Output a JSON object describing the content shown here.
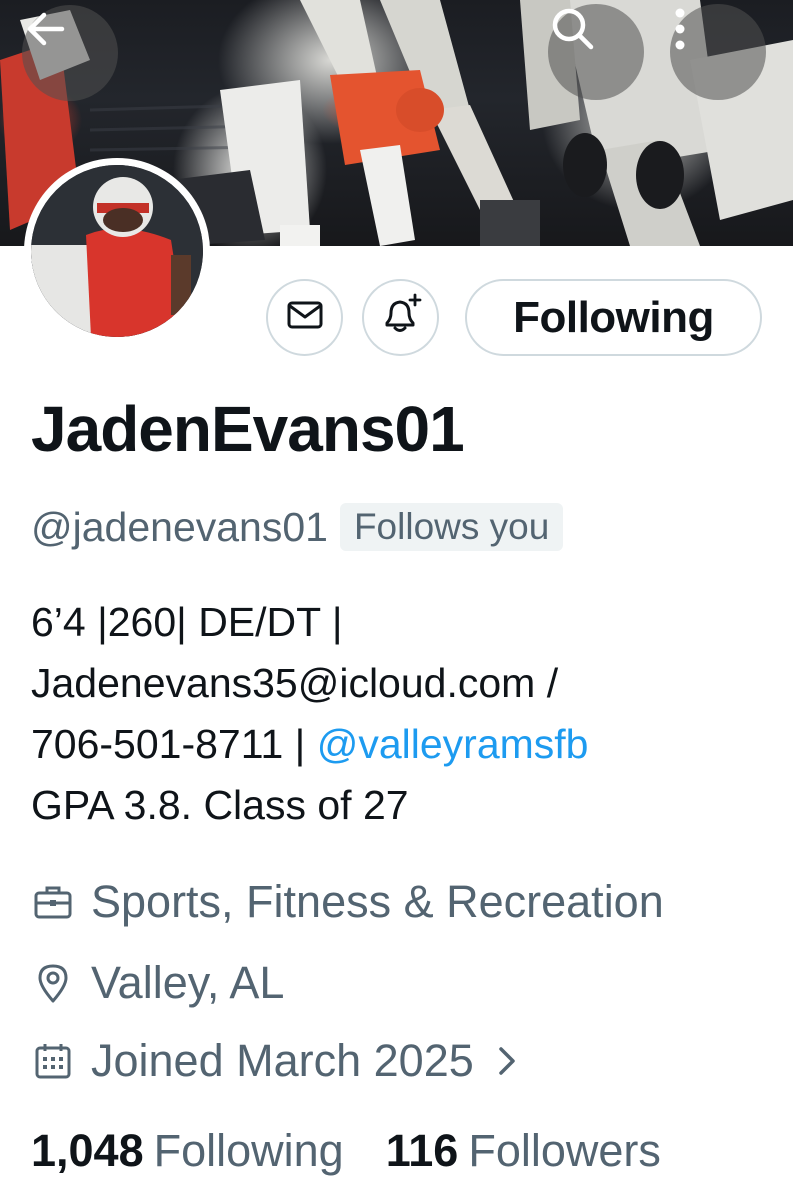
{
  "header": {
    "back_icon": "arrow-left-icon",
    "search_icon": "search-icon",
    "more_icon": "more-vertical-icon"
  },
  "profile": {
    "display_name": "JadenEvans01",
    "handle": "@jadenevans01",
    "follows_you_badge": "Follows you",
    "bio": {
      "line1": "6’4 |260| DE/DT |",
      "line2": "Jadenevans35@icloud.com /",
      "line3_text": "706-501-8711 | ",
      "line3_mention": "@valleyramsfb",
      "line4": "GPA 3.8. Class of 27"
    },
    "category": "Sports, Fitness & Recreation",
    "location": "Valley, AL",
    "joined": "Joined March 2025",
    "following_count": "1,048",
    "following_label": "Following",
    "followers_count": "116",
    "followers_label": "Followers"
  },
  "actions": {
    "message_icon": "envelope-icon",
    "notify_icon": "bell-plus-icon",
    "follow_button_label": "Following"
  },
  "colors": {
    "text_primary": "#0f1419",
    "text_secondary": "#536471",
    "link": "#1d9bf0",
    "border": "#cfd9de",
    "badge_bg": "#eff3f4"
  }
}
